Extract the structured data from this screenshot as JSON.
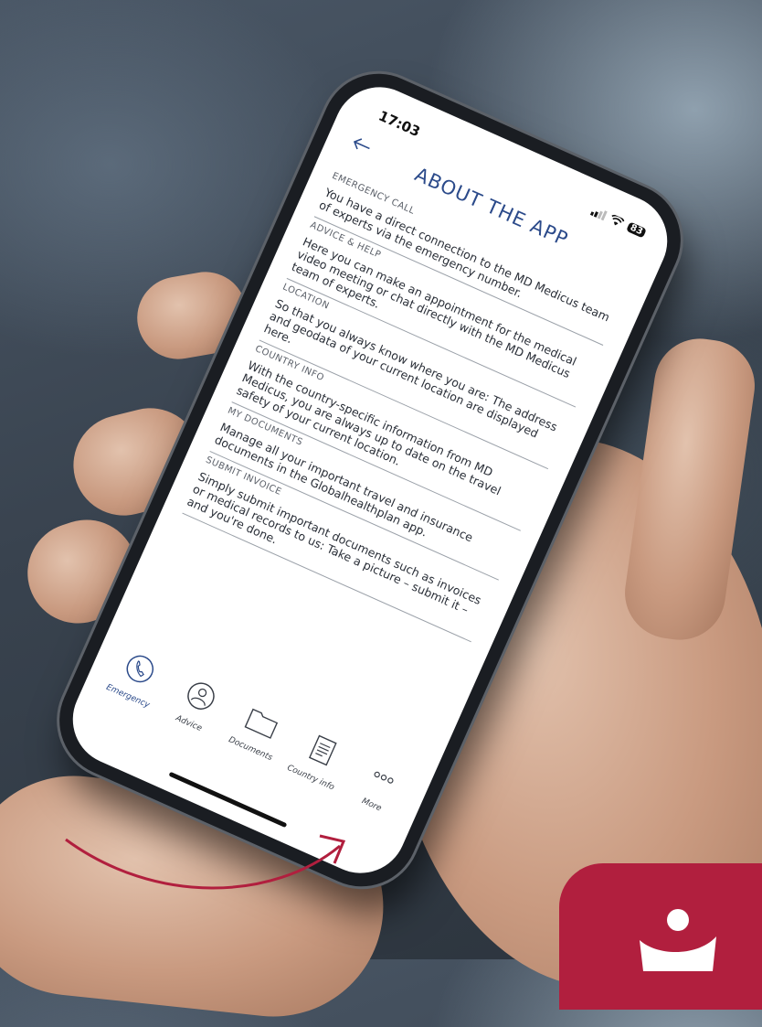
{
  "status_bar": {
    "time": "17:03",
    "battery": "83"
  },
  "page": {
    "title": "ABOUT THE APP",
    "back_icon": "arrow-left-icon"
  },
  "sections": [
    {
      "title": "EMERGENCY CALL",
      "text": "You have a direct connection to the MD Medicus team of experts via the emergency number."
    },
    {
      "title": "ADVICE & HELP",
      "text": "Here you can make an appointment for the medical video meeting or chat directly with the MD Medicus team of experts."
    },
    {
      "title": "LOCATION",
      "text": "So that you always know where you are: The address and geodata of your current location are displayed here."
    },
    {
      "title": "COUNTRY INFO",
      "text": "With the country-specific information from MD Medicus, you are always up to date on the travel safety of your current location."
    },
    {
      "title": "MY DOCUMENTS",
      "text": "Manage all your important travel and insurance documents in the Globalhealthplan app."
    },
    {
      "title": "SUBMIT INVOICE",
      "text": "Simply submit important documents such as invoices or medical records to us: Take a picture – submit it – and you're done."
    }
  ],
  "tabs": [
    {
      "label": "Emergency",
      "icon": "phone-icon",
      "active": true
    },
    {
      "label": "Advice",
      "icon": "doctor-icon",
      "active": false
    },
    {
      "label": "Documents",
      "icon": "folder-icon",
      "active": false
    },
    {
      "label": "Country info",
      "icon": "document-icon",
      "active": false
    },
    {
      "label": "More",
      "icon": "more-dots-icon",
      "active": false
    }
  ],
  "colors": {
    "accent": "#2b4a8a",
    "brand_badge": "#b11f3e",
    "arrow": "#b11f3e"
  }
}
